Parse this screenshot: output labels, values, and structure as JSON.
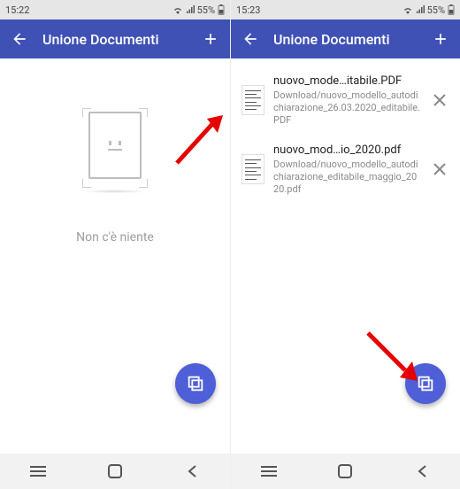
{
  "left": {
    "statusbar": {
      "time": "15:22",
      "battery": "55%"
    },
    "appbar": {
      "title": "Unione Documenti"
    },
    "empty_text": "Non c'è niente"
  },
  "right": {
    "statusbar": {
      "time": "15:23",
      "battery": "55%"
    },
    "appbar": {
      "title": "Unione Documenti"
    },
    "files": [
      {
        "name": "nuovo_mode…itabile.PDF",
        "path": "Download/nuovo_modello_autodichiarazione_26.03.2020_editabile.PDF"
      },
      {
        "name": "nuovo_mod…io_2020.pdf",
        "path": "Download/nuovo_modello_autodichiarazione_editabile_maggio_2020.pdf"
      }
    ]
  }
}
